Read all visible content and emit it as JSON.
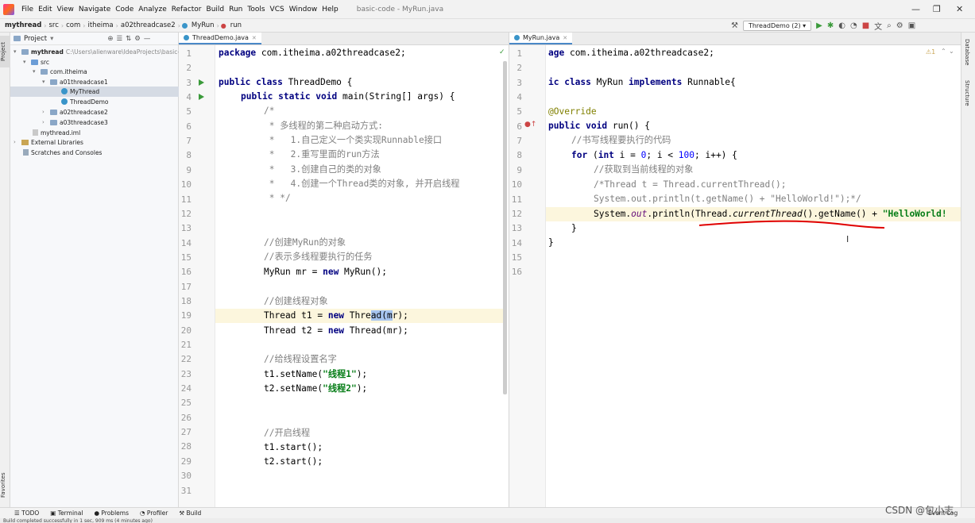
{
  "menubar": {
    "items": [
      "File",
      "Edit",
      "View",
      "Navigate",
      "Code",
      "Analyze",
      "Refactor",
      "Build",
      "Run",
      "Tools",
      "VCS",
      "Window",
      "Help"
    ],
    "window_title": "basic-code - MyRun.java"
  },
  "navbar": {
    "crumbs": [
      "mythread",
      "src",
      "com",
      "itheima",
      "a02threadcase2",
      "MyRun",
      "run"
    ],
    "run_config": "ThreadDemo (2)"
  },
  "left_strip": {
    "project_tab": "Project",
    "favorites_tab": "Favorites"
  },
  "right_strip": {
    "database_tab": "Database",
    "structure_tab": "Structure"
  },
  "project": {
    "header": "Project",
    "tree": [
      {
        "label": "mythread",
        "extra": "C:\\Users\\alienware\\IdeaProjects\\basic-"
      },
      {
        "label": "src"
      },
      {
        "label": "com.itheima"
      },
      {
        "label": "a01threadcase1"
      },
      {
        "label": "MyThread"
      },
      {
        "label": "ThreadDemo"
      },
      {
        "label": "a02threadcase2"
      },
      {
        "label": "a03threadcase3"
      },
      {
        "label": "mythread.iml"
      },
      {
        "label": "External Libraries"
      },
      {
        "label": "Scratches and Consoles"
      }
    ]
  },
  "left_editor": {
    "tab": "ThreadDemo.java",
    "lines": [
      "1",
      "2",
      "3",
      "4",
      "5",
      "6",
      "7",
      "8",
      "9",
      "10",
      "11",
      "12",
      "13",
      "14",
      "15",
      "16",
      "17",
      "18",
      "19",
      "20",
      "21",
      "22",
      "23",
      "24",
      "25",
      "26",
      "27",
      "28",
      "29",
      "30",
      "31"
    ],
    "code": {
      "l1a": "package",
      "l1b": " com.itheima.a02threadcase2;",
      "l3a": "public class",
      "l3b": " ThreadDemo {",
      "l4a": "public static void",
      "l4b": " main(String[] args) {",
      "l5": "/*",
      "l6": " * 多线程的第二种启动方式:",
      "l7": " *   1.自己定义一个类实现Runnable接口",
      "l8": " *   2.重写里面的run方法",
      "l9": " *   3.创建自己的类的对象",
      "l10": " *   4.创建一个Thread类的对象, 并开启线程",
      "l11": " * */",
      "l14": "//创建MyRun的对象",
      "l15": "//表示多线程要执行的任务",
      "l16a": "MyRun mr = ",
      "l16b": "new",
      "l16c": " MyRun();",
      "l18": "//创建线程对象",
      "l19a": "Thread t1 = ",
      "l19b": "new",
      "l19c": " Thre",
      "l19d": "ad(m",
      "l19e": "r);",
      "l20a": "Thread t2 = ",
      "l20b": "new",
      "l20c": " Thread(mr);",
      "l22": "//给线程设置名字",
      "l23a": "t1.setName(",
      "l23b": "\"线程1\"",
      "l23c": ");",
      "l24a": "t2.setName(",
      "l24b": "\"线程2\"",
      "l24c": ");",
      "l27": "//开启线程",
      "l28": "t1.start();",
      "l29": "t2.start();"
    }
  },
  "right_editor": {
    "tab": "MyRun.java",
    "warning_count": "1",
    "lines": [
      "1",
      "2",
      "3",
      "4",
      "5",
      "6",
      "7",
      "8",
      "9",
      "10",
      "11",
      "12",
      "13",
      "14",
      "15",
      "16"
    ],
    "code": {
      "r1a": "age",
      "r1b": " com.itheima.a02threadcase2;",
      "r3a": "ic class",
      "r3b": " MyRun ",
      "r3c": "implements",
      "r3d": " Runnable{",
      "r5": "@Override",
      "r6a": "public void",
      "r6b": " run() {",
      "r7": "//书写线程要执行的代码",
      "r8a": "for",
      "r8b": " (",
      "r8c": "int",
      "r8d": " i = ",
      "r8e": "0",
      "r8f": "; i < ",
      "r8g": "100",
      "r8h": "; i++) {",
      "r9": "//获取到当前线程的对象",
      "r10": "/*Thread t = Thread.currentThread();",
      "r11": "System.out.println(t.getName() + \"HelloWorld!\");*/",
      "r12a": "System.",
      "r12b": "out",
      "r12c": ".println(Thread.",
      "r12d": "currentThread",
      "r12e": "().getName() + ",
      "r12f": "\"HelloWorld!",
      "r13": "}",
      "r14": "}"
    }
  },
  "bottom_bar": {
    "items": [
      "TODO",
      "Terminal",
      "Problems",
      "Profiler",
      "Build"
    ],
    "event_log": "Event Log"
  },
  "status": "Build completed successfully in 1 sec, 909 ms (4 minutes ago)",
  "watermark": "CSDN @包小志",
  "colors": {
    "keyword": "#000080",
    "comment": "#808080",
    "string": "#067d17",
    "number": "#0000ff",
    "annotation": "#808000",
    "underline": "#e00000"
  }
}
